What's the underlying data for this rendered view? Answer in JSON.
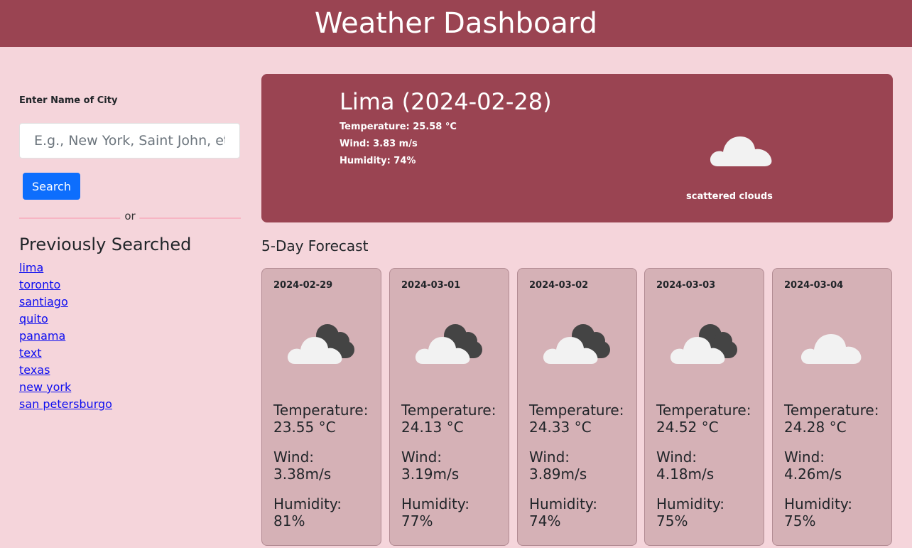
{
  "header": {
    "title": "Weather Dashboard"
  },
  "search": {
    "label": "Enter Name of City",
    "placeholder": "E.g., New York, Saint John, etc.",
    "button_label": "Search",
    "divider_text": "or"
  },
  "history": {
    "title": "Previously Searched",
    "items": [
      "lima",
      "toronto",
      "santiago",
      "quito",
      "panama",
      "text",
      "texas",
      "new york",
      "san petersburgo"
    ]
  },
  "current": {
    "city_date": "Lima (2024-02-28)",
    "temperature": "Temperature: 25.58 °C",
    "wind": "Wind: 3.83 m/s",
    "humidity": "Humidity: 74%",
    "description": "scattered clouds",
    "icon": "cloud-icon"
  },
  "forecast": {
    "title": "5-Day Forecast",
    "days": [
      {
        "date": "2024-02-29",
        "icon": "broken-clouds-icon",
        "temp_label": "Temperature:",
        "temp": "23.55 °C",
        "wind_label": "Wind:",
        "wind": "3.38m/s",
        "humidity_label": "Humidity:",
        "humidity": "81%"
      },
      {
        "date": "2024-03-01",
        "icon": "broken-clouds-icon",
        "temp_label": "Temperature:",
        "temp": "24.13 °C",
        "wind_label": "Wind:",
        "wind": "3.19m/s",
        "humidity_label": "Humidity:",
        "humidity": "77%"
      },
      {
        "date": "2024-03-02",
        "icon": "broken-clouds-icon",
        "temp_label": "Temperature:",
        "temp": "24.33 °C",
        "wind_label": "Wind:",
        "wind": "3.89m/s",
        "humidity_label": "Humidity:",
        "humidity": "74%"
      },
      {
        "date": "2024-03-03",
        "icon": "broken-clouds-icon",
        "temp_label": "Temperature:",
        "temp": "24.52 °C",
        "wind_label": "Wind:",
        "wind": "4.18m/s",
        "humidity_label": "Humidity:",
        "humidity": "75%"
      },
      {
        "date": "2024-03-04",
        "icon": "cloud-icon",
        "temp_label": "Temperature:",
        "temp": "24.28 °C",
        "wind_label": "Wind:",
        "wind": "4.26m/s",
        "humidity_label": "Humidity:",
        "humidity": "75%"
      }
    ]
  },
  "colors": {
    "page_bg": "#f5d5db",
    "accent": "#9a4452",
    "card_bg": "#d5b1b6",
    "button": "#0d6efd",
    "link": "#0d0df0"
  }
}
